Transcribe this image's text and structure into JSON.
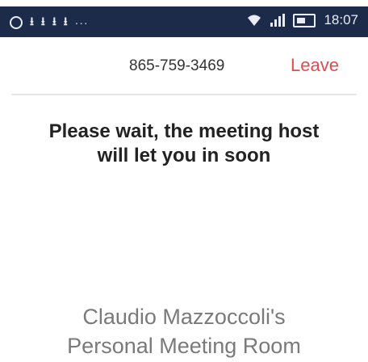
{
  "status_bar": {
    "time": "18:07",
    "left_icons": [
      "circle-icon",
      "download-icon",
      "download-icon",
      "download-icon",
      "download-icon",
      "more-icon"
    ],
    "right_icons": [
      "wifi-icon",
      "signal-icon",
      "battery-icon"
    ],
    "background": "#1c2b4a"
  },
  "header": {
    "meeting_id": "865-759-3469",
    "leave_label": "Leave",
    "leave_color": "#e54b4b"
  },
  "main": {
    "wait_line1": "Please wait, the meeting host",
    "wait_line2": "will let you in soon",
    "room_line1": "Claudio Mazzoccoli's",
    "room_line2": "Personal Meeting Room"
  }
}
